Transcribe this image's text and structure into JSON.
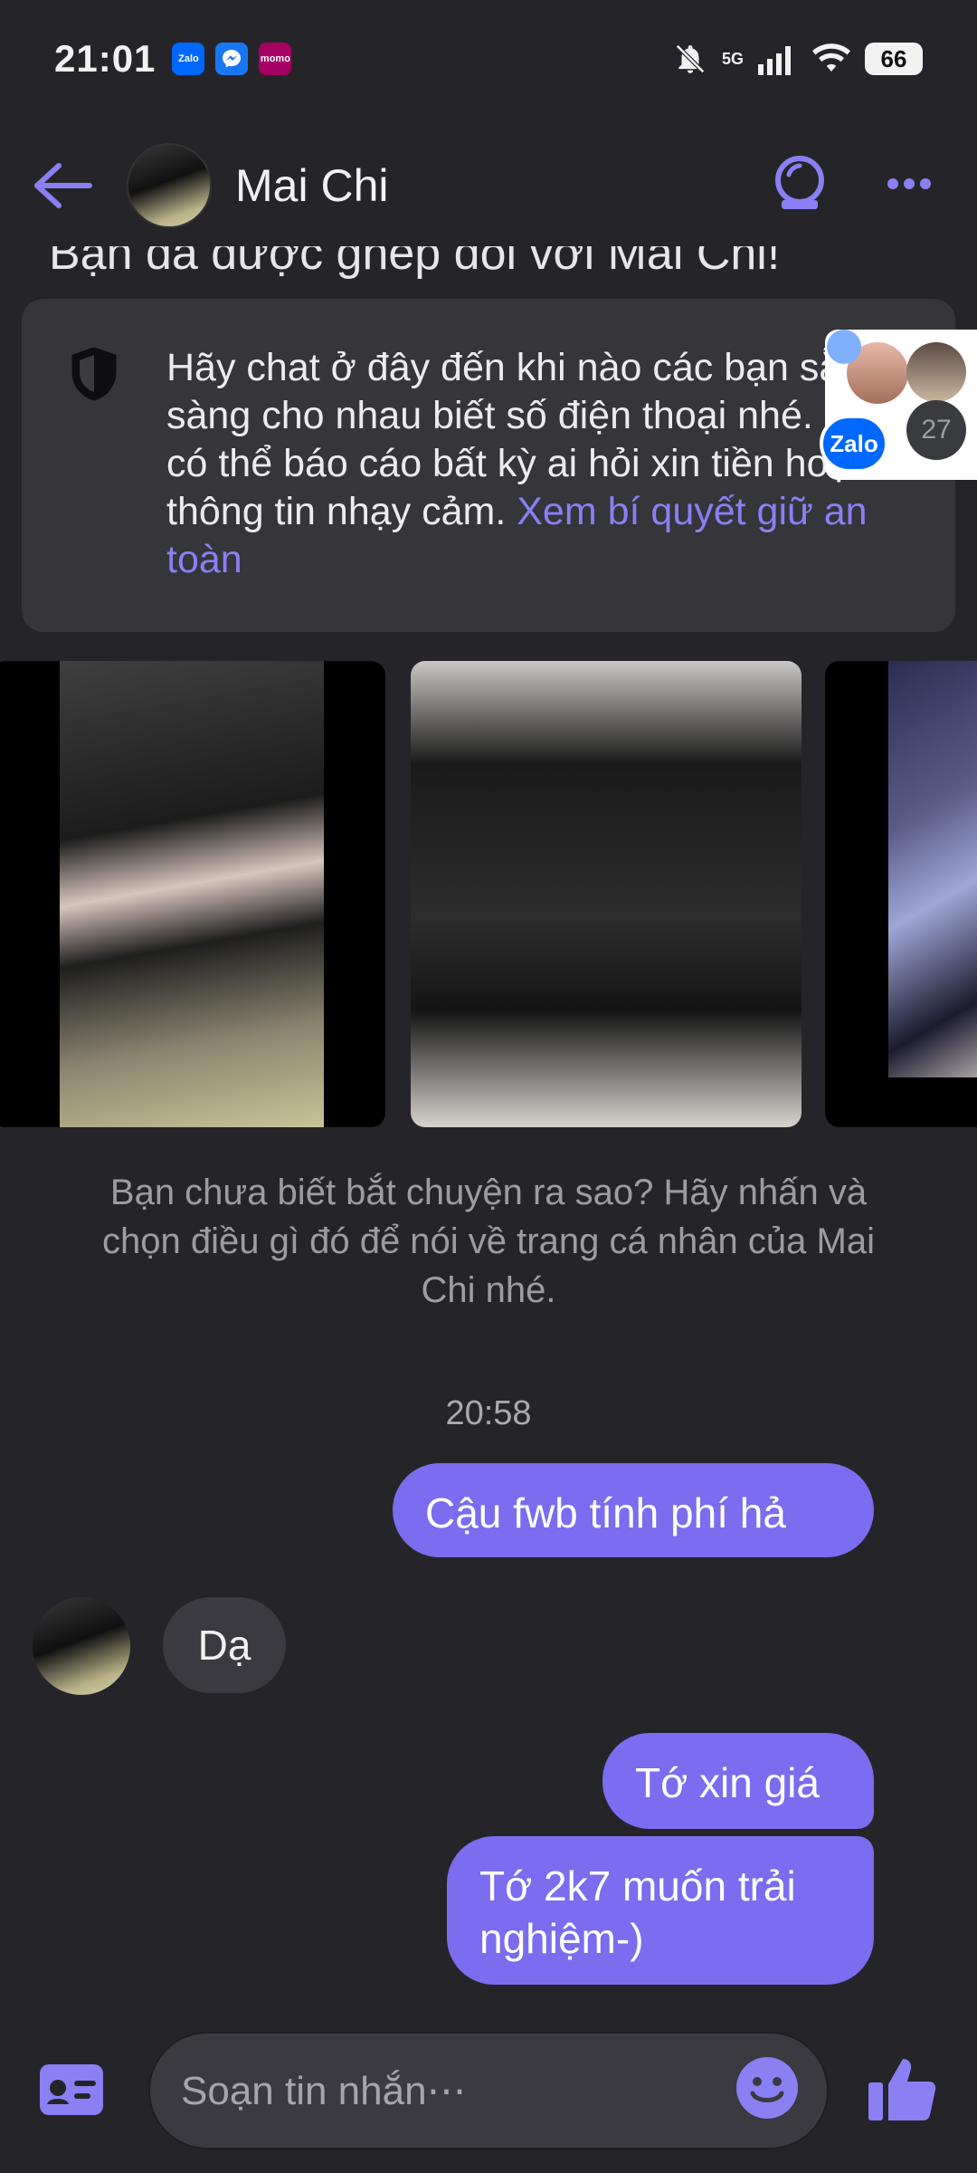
{
  "status_bar": {
    "time": "21:01",
    "apps": [
      "Zalo",
      "Messenger",
      "momo"
    ],
    "network": "5G",
    "battery": "66"
  },
  "header": {
    "contact_name": "Mai Chi"
  },
  "match_banner": "Bạn đã được ghép đôi với Mai Chi!",
  "safety_card": {
    "text": "Hãy chat ở đây đến khi nào các bạn sẵn sàng cho nhau biết số điện thoại nhé. Bạn có thể báo cáo bất kỳ ai hỏi xin tiền hoặc thông tin nhạy cảm.",
    "link": "Xem bí quyết giữ an toàn"
  },
  "floating_bubble": {
    "app": "Zalo",
    "count": "27"
  },
  "prompt_text": "Bạn chưa biết bắt chuyện ra sao? Hãy nhấn và chọn điều gì đó để nói về trang cá nhân của Mai Chi nhé.",
  "conversation": {
    "timestamp": "20:58",
    "messages": [
      {
        "direction": "outgoing",
        "text": "Cậu fwb tính phí hả"
      },
      {
        "direction": "incoming",
        "text": "Dạ"
      },
      {
        "direction": "outgoing",
        "text": "Tớ xin giá"
      },
      {
        "direction": "outgoing",
        "text": "Tớ 2k7 muốn trải nghiệm-)"
      }
    ]
  },
  "composer": {
    "placeholder": "Soạn tin nhắn⋯"
  },
  "colors": {
    "accent": "#7b6cf0",
    "background": "#252529",
    "card": "#35353a"
  }
}
